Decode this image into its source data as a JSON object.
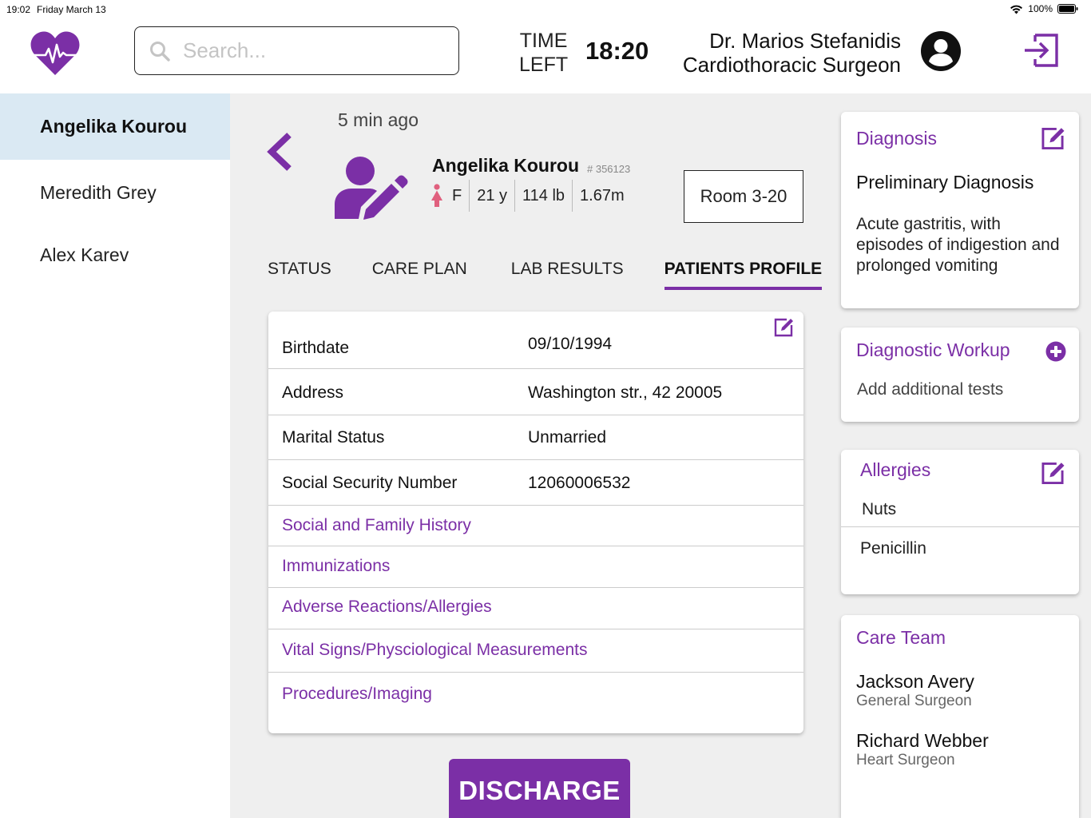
{
  "status_bar": {
    "time": "19:02",
    "date": "Friday March 13",
    "battery": "100%"
  },
  "header": {
    "search_placeholder": "Search...",
    "time_left_label_1": "TIME",
    "time_left_label_2": "LEFT",
    "time_left_value": "18:20",
    "doctor_name": "Dr. Marios Stefanidis",
    "doctor_role": "Cardiothoracic Surgeon"
  },
  "sidebar": {
    "items": [
      {
        "label": "Angelika Kourou",
        "active": true
      },
      {
        "label": "Meredith Grey",
        "active": false
      },
      {
        "label": "Alex Karev",
        "active": false
      }
    ]
  },
  "patient": {
    "time_ago": "5 min ago",
    "name": "Angelika Kourou",
    "id": "# 356123",
    "sex": "F",
    "age": "21 y",
    "weight": "114 lb",
    "height": "1.67m",
    "room": "Room 3-20"
  },
  "tabs": [
    {
      "label": "STATUS",
      "active": false
    },
    {
      "label": "CARE PLAN",
      "active": false
    },
    {
      "label": "LAB RESULTS",
      "active": false
    },
    {
      "label": "PATIENTS PROFILE",
      "active": true
    }
  ],
  "profile": {
    "fields": [
      {
        "label": "Birthdate",
        "value": "09/10/1994"
      },
      {
        "label": "Address",
        "value": "Washington str., 42 20005"
      },
      {
        "label": "Marital Status",
        "value": "Unmarried"
      },
      {
        "label": "Social Security Number",
        "value": "12060006532"
      }
    ],
    "links": [
      "Social and Family History",
      "Immunizations",
      "Adverse Reactions/Allergies",
      "Vital Signs/Physciological Measurements",
      "Procedures/Imaging"
    ]
  },
  "discharge_label": "DISCHARGE",
  "diagnosis": {
    "title": "Diagnosis",
    "subtitle": "Preliminary Diagnosis",
    "text": "Acute gastritis, with episodes of indigestion and prolonged vomiting"
  },
  "workup": {
    "title": "Diagnostic Workup",
    "text": "Add additional tests"
  },
  "allergies": {
    "title": "Allergies",
    "items": [
      "Nuts",
      "Penicillin"
    ]
  },
  "care_team": {
    "title": "Care Team",
    "members": [
      {
        "name": "Jackson Avery",
        "role": "General Surgeon"
      },
      {
        "name": "Richard Webber",
        "role": "Heart Surgeon"
      }
    ]
  },
  "colors": {
    "accent": "#7b2fa6",
    "sidebar_active": "#dae9f3",
    "main_bg": "#efefef",
    "female_icon": "#e0607e"
  }
}
